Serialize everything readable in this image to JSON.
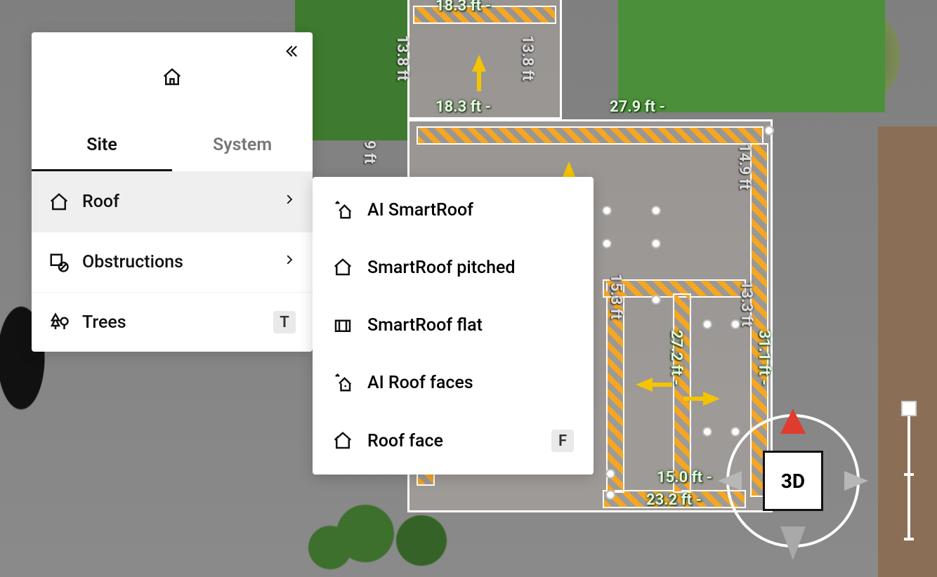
{
  "panel": {
    "tabs": {
      "site": "Site",
      "system": "System",
      "active": "site"
    },
    "items": [
      {
        "label": "Roof",
        "shortcut": "",
        "has_children": true,
        "selected": true
      },
      {
        "label": "Obstructions",
        "shortcut": "",
        "has_children": true,
        "selected": false
      },
      {
        "label": "Trees",
        "shortcut": "T",
        "has_children": false,
        "selected": false
      }
    ]
  },
  "submenu": {
    "items": [
      {
        "label": "AI SmartRoof",
        "shortcut": ""
      },
      {
        "label": "SmartRoof pitched",
        "shortcut": ""
      },
      {
        "label": "SmartRoof flat",
        "shortcut": ""
      },
      {
        "label": "AI Roof faces",
        "shortcut": ""
      },
      {
        "label": "Roof face",
        "shortcut": "F"
      }
    ]
  },
  "compass": {
    "label": "3D"
  },
  "dims": {
    "top_upper": "18.3 ft -",
    "upper_left": "13.8 ft",
    "upper_right": "13.8 ft",
    "top_main_l": "18.3 ft -",
    "top_main_r": "27.9 ft -",
    "hatch_l": "9 ft",
    "right_side": "14.9 ft",
    "inner_r": "13.3 ft",
    "inner_l": "15.3 ft",
    "left_wing": "27.2 ft -",
    "right_wing": "31.1 ft -",
    "bot_l": "15.0 ft -",
    "bot_r": "23.2 ft -"
  }
}
